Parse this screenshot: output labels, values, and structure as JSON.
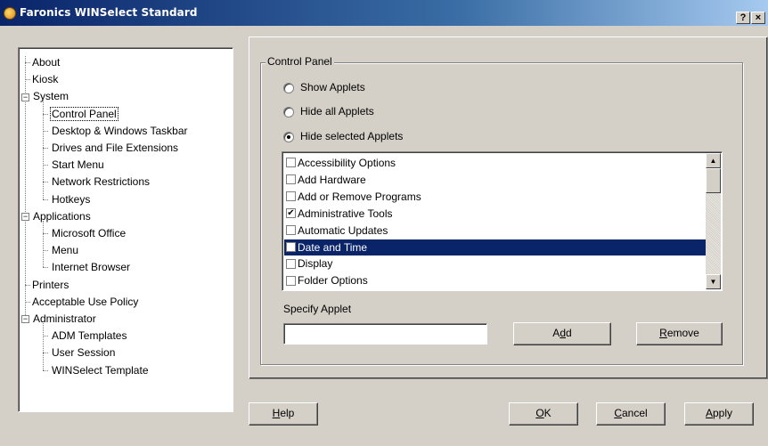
{
  "window": {
    "title": "Faronics WINSelect Standard",
    "icon": "faronics-app-icon",
    "help_button": "?",
    "close_button": "×"
  },
  "tree": {
    "items": [
      {
        "label": "About",
        "level": 0,
        "expander": null
      },
      {
        "label": "Kiosk",
        "level": 0,
        "expander": null
      },
      {
        "label": "System",
        "level": 0,
        "expander": "−"
      },
      {
        "label": "Control Panel",
        "level": 1,
        "expander": null,
        "selected": true
      },
      {
        "label": "Desktop & Windows Taskbar",
        "level": 1,
        "expander": null
      },
      {
        "label": "Drives and File Extensions",
        "level": 1,
        "expander": null
      },
      {
        "label": "Start Menu",
        "level": 1,
        "expander": null
      },
      {
        "label": "Network Restrictions",
        "level": 1,
        "expander": null
      },
      {
        "label": "Hotkeys",
        "level": 1,
        "expander": null
      },
      {
        "label": "Applications",
        "level": 0,
        "expander": "−"
      },
      {
        "label": "Microsoft Office",
        "level": 1,
        "expander": null
      },
      {
        "label": "Menu",
        "level": 1,
        "expander": null
      },
      {
        "label": "Internet Browser",
        "level": 1,
        "expander": null
      },
      {
        "label": "Printers",
        "level": 0,
        "expander": null
      },
      {
        "label": "Acceptable Use Policy",
        "level": 0,
        "expander": null
      },
      {
        "label": "Administrator",
        "level": 0,
        "expander": "−"
      },
      {
        "label": "ADM Templates",
        "level": 1,
        "expander": null
      },
      {
        "label": "User Session",
        "level": 1,
        "expander": null
      },
      {
        "label": "WINSelect Template",
        "level": 1,
        "expander": null
      }
    ]
  },
  "control_panel": {
    "group_label": "Control Panel",
    "radios": [
      {
        "label": "Show Applets",
        "checked": false
      },
      {
        "label": "Hide all Applets",
        "checked": false
      },
      {
        "label": "Hide selected Applets",
        "checked": true
      }
    ],
    "applets": [
      {
        "label": "Accessibility Options",
        "checked": false,
        "selected": false
      },
      {
        "label": "Add Hardware",
        "checked": false,
        "selected": false
      },
      {
        "label": "Add or Remove Programs",
        "checked": false,
        "selected": false
      },
      {
        "label": "Administrative Tools",
        "checked": true,
        "selected": false
      },
      {
        "label": "Automatic Updates",
        "checked": false,
        "selected": false
      },
      {
        "label": "Date and Time",
        "checked": false,
        "selected": true
      },
      {
        "label": "Display",
        "checked": false,
        "selected": false
      },
      {
        "label": "Folder Options",
        "checked": false,
        "selected": false
      }
    ],
    "specify_label": "Specify Applet",
    "specify_value": "",
    "add_button": {
      "pre": "A",
      "u": "d",
      "post": "d"
    },
    "remove_button": {
      "pre": "",
      "u": "R",
      "post": "emove"
    }
  },
  "buttons": {
    "help": {
      "pre": "",
      "u": "H",
      "post": "elp"
    },
    "ok": {
      "pre": "",
      "u": "O",
      "post": "K"
    },
    "cancel": {
      "pre": "",
      "u": "C",
      "post": "ancel"
    },
    "apply": {
      "pre": "",
      "u": "A",
      "post": "pply"
    }
  },
  "colors": {
    "titlebar_start": "#0a246a",
    "titlebar_end": "#a6caf0",
    "selection": "#0a246a",
    "face": "#d4d0c8"
  }
}
